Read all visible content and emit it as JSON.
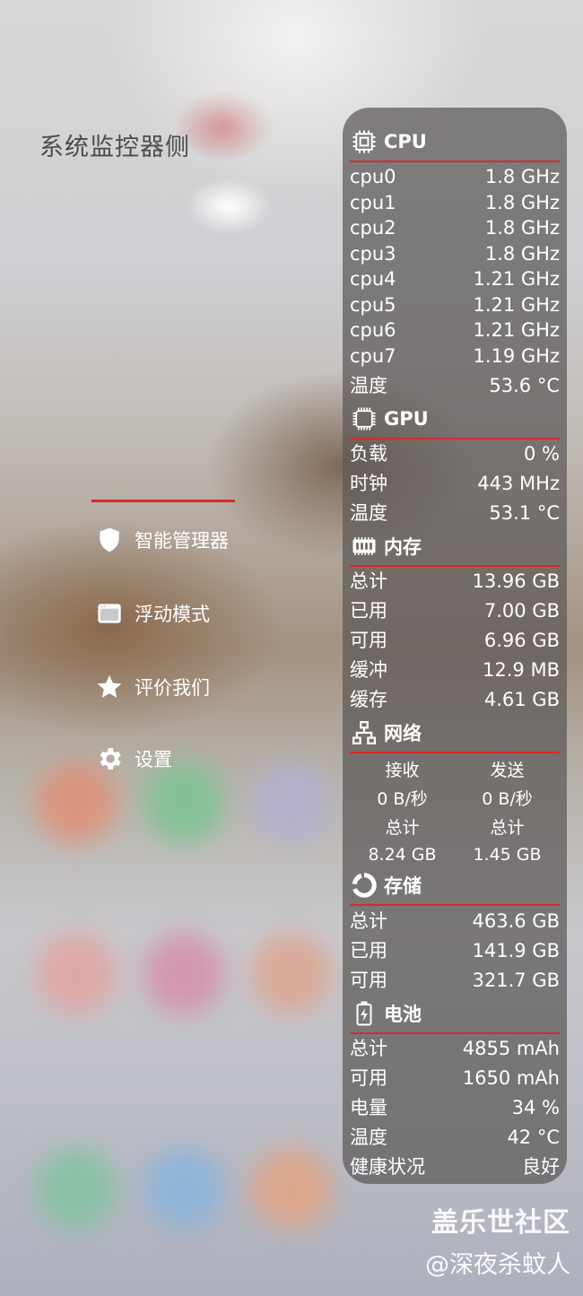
{
  "drawer": {
    "title": "系统监控器侧",
    "menu": [
      {
        "label": "智能管理器",
        "icon": "shield-icon"
      },
      {
        "label": "浮动模式",
        "icon": "window-icon"
      },
      {
        "label": "评价我们",
        "icon": "star-icon"
      },
      {
        "label": "设置",
        "icon": "gear-icon"
      }
    ]
  },
  "panel": {
    "cpu": {
      "title": "CPU",
      "icon": "cpu-chip-icon",
      "rows": [
        {
          "label": "cpu0",
          "value": "1.8 GHz"
        },
        {
          "label": "cpu1",
          "value": "1.8 GHz"
        },
        {
          "label": "cpu2",
          "value": "1.8 GHz"
        },
        {
          "label": "cpu3",
          "value": "1.8 GHz"
        },
        {
          "label": "cpu4",
          "value": "1.21 GHz"
        },
        {
          "label": "cpu5",
          "value": "1.21 GHz"
        },
        {
          "label": "cpu6",
          "value": "1.21 GHz"
        },
        {
          "label": "cpu7",
          "value": "1.19 GHz"
        },
        {
          "label": "温度",
          "value": "53.6 °C"
        }
      ]
    },
    "gpu": {
      "title": "GPU",
      "icon": "gpu-chip-icon",
      "rows": [
        {
          "label": "负载",
          "value": "0 %"
        },
        {
          "label": "时钟",
          "value": "443 MHz"
        },
        {
          "label": "温度",
          "value": "53.1 °C"
        }
      ]
    },
    "memory": {
      "title": "内存",
      "icon": "memory-icon",
      "rows": [
        {
          "label": "总计",
          "value": "13.96 GB"
        },
        {
          "label": "已用",
          "value": "7.00 GB"
        },
        {
          "label": "可用",
          "value": "6.96 GB"
        },
        {
          "label": "缓冲",
          "value": "12.9 MB"
        },
        {
          "label": "缓存",
          "value": "4.61 GB"
        }
      ]
    },
    "network": {
      "title": "网络",
      "icon": "network-icon",
      "receive_label": "接收",
      "send_label": "发送",
      "receive_rate": "0 B/秒",
      "send_rate": "0 B/秒",
      "receive_total_label": "总计",
      "send_total_label": "总计",
      "receive_total": "8.24 GB",
      "send_total": "1.45 GB"
    },
    "storage": {
      "title": "存储",
      "icon": "storage-ring-icon",
      "rows": [
        {
          "label": "总计",
          "value": "463.6 GB"
        },
        {
          "label": "已用",
          "value": "141.9 GB"
        },
        {
          "label": "可用",
          "value": "321.7 GB"
        }
      ]
    },
    "battery": {
      "title": "电池",
      "icon": "battery-charging-icon",
      "rows": [
        {
          "label": "总计",
          "value": "4855 mAh"
        },
        {
          "label": "可用",
          "value": "1650 mAh"
        },
        {
          "label": "电量",
          "value": "34 %"
        },
        {
          "label": "温度",
          "value": "42 °C"
        },
        {
          "label": "健康状况",
          "value": "良好"
        }
      ]
    }
  },
  "watermark": {
    "line1": "盖乐世社区",
    "line2": "@深夜杀蚊人"
  },
  "colors": {
    "accent": "#d62b2b",
    "panel_bg": "#5c5858",
    "text": "#ffffff",
    "title_text": "#4c4c4e"
  }
}
